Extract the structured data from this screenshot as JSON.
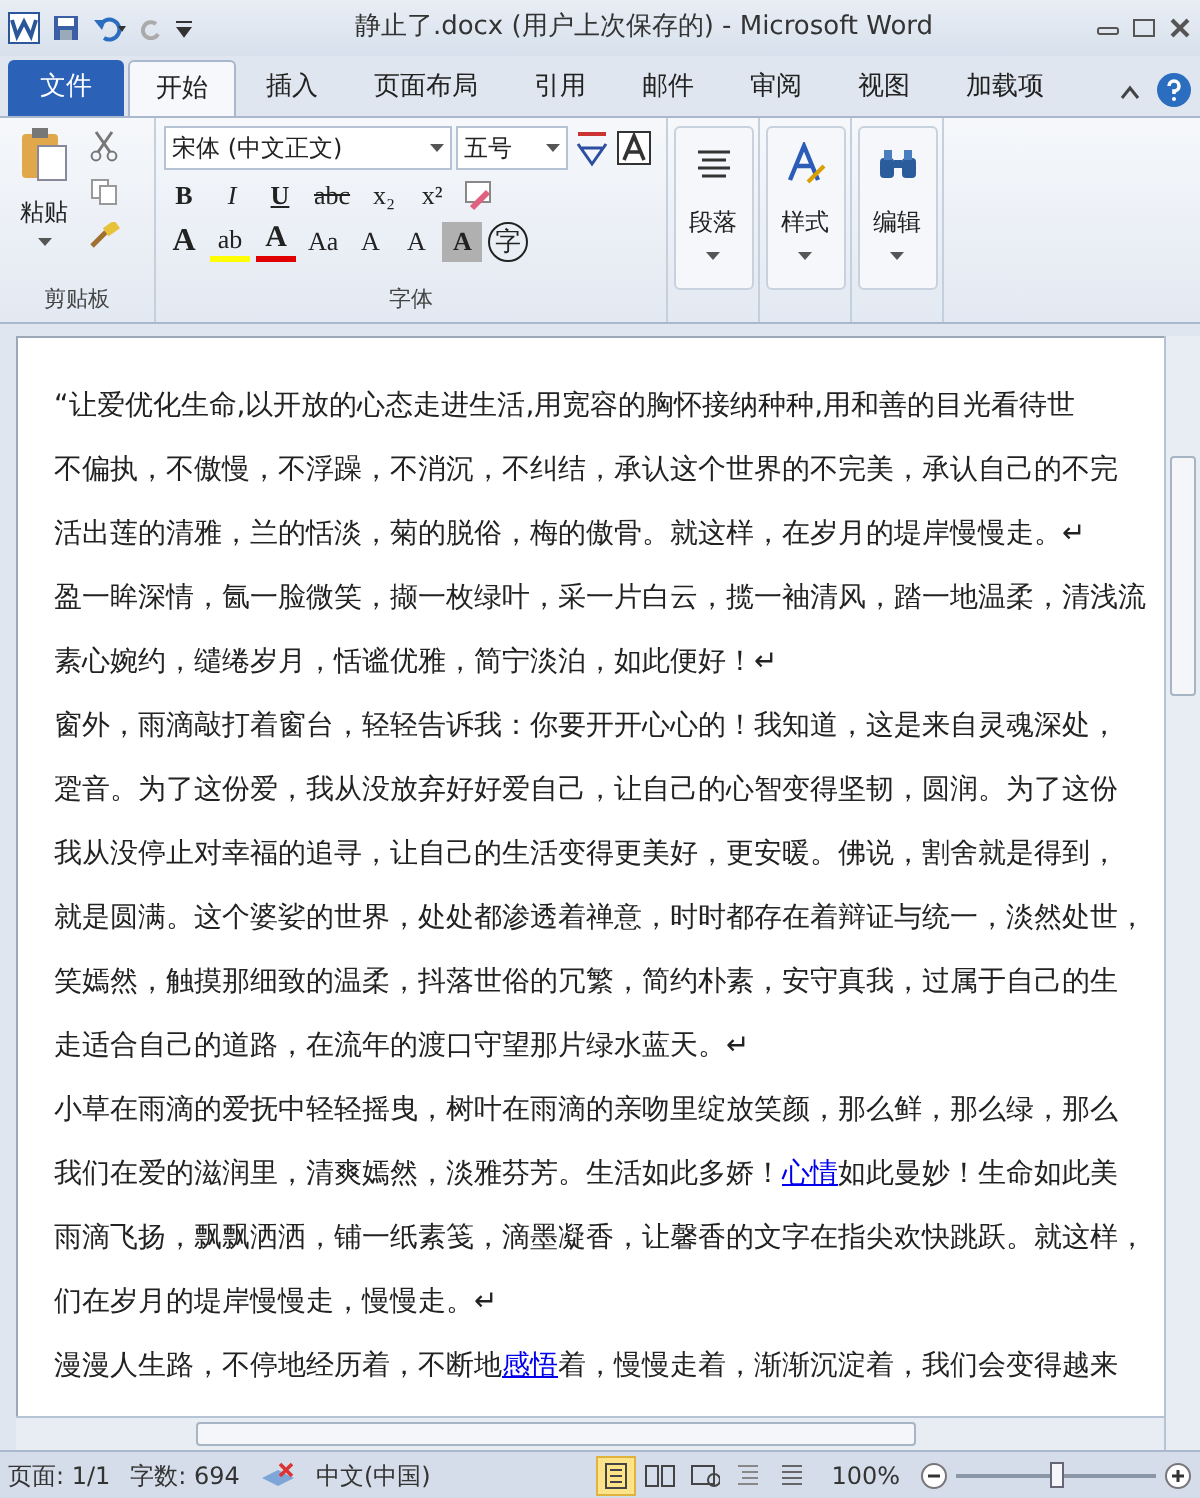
{
  "window": {
    "title": "静止了.docx (用户上次保存的)  -  Microsoft Word"
  },
  "tabs": [
    {
      "label": "文件",
      "kind": "file",
      "selected": false
    },
    {
      "label": "开始",
      "kind": "tab",
      "selected": true
    },
    {
      "label": "插入",
      "kind": "tab",
      "selected": false
    },
    {
      "label": "页面布局",
      "kind": "tab",
      "selected": false
    },
    {
      "label": "引用",
      "kind": "tab",
      "selected": false
    },
    {
      "label": "邮件",
      "kind": "tab",
      "selected": false
    },
    {
      "label": "审阅",
      "kind": "tab",
      "selected": false
    },
    {
      "label": "视图",
      "kind": "tab",
      "selected": false
    },
    {
      "label": "加载项",
      "kind": "tab",
      "selected": false
    }
  ],
  "ribbon": {
    "clipboard": {
      "paste": "粘贴",
      "label": "剪贴板"
    },
    "font": {
      "name": "宋体 (中文正文)",
      "size": "五号",
      "label": "字体",
      "row1": [
        {
          "text": "B",
          "kind": "bold"
        },
        {
          "text": "I",
          "kind": "italic"
        },
        {
          "text": "U",
          "kind": "underline"
        },
        {
          "text": "abc",
          "kind": "strike"
        },
        {
          "text": "x₂",
          "kind": "plain"
        },
        {
          "text": "x²",
          "kind": "plain"
        }
      ],
      "row2": [
        {
          "text": "A",
          "kind": "effect"
        },
        {
          "text": "ab",
          "kind": "highlight"
        },
        {
          "text": "A",
          "kind": "color"
        },
        {
          "text": "Aa",
          "kind": "plain"
        },
        {
          "text": "A",
          "kind": "plain"
        },
        {
          "text": "A",
          "kind": "plain"
        },
        {
          "text": "A",
          "kind": "shade"
        },
        {
          "text": "字",
          "kind": "circle"
        }
      ]
    },
    "groups": [
      {
        "label": "段落",
        "kind": "paragraph"
      },
      {
        "label": "样式",
        "kind": "styles"
      },
      {
        "label": "编辑",
        "kind": "editing"
      }
    ]
  },
  "document": {
    "lines": [
      [
        {
          "text": "“让爱优化生命,以开放的心态走进生活,用宽容的胸怀接纳种种,用和善的目光看待世",
          "link": false
        }
      ],
      [
        {
          "text": "不偏执，不傲慢，不浮躁，不消沉，不纠结，承认这个世界的不完美，承认自己的不完",
          "link": false
        }
      ],
      [
        {
          "text": "活出莲的清雅，兰的恬淡，菊的脱俗，梅的傲骨。就这样，在岁月的堤岸慢慢走。↵",
          "link": false
        }
      ],
      [
        {
          "text": "盈一眸深情，氤一脸微笑，撷一枚绿叶，采一片白云，揽一袖清风，踏一地温柔，清浅流",
          "link": false
        }
      ],
      [
        {
          "text": "素心婉约，缱绻岁月，恬谧优雅，简宁淡泊，如此便好！↵",
          "link": false
        }
      ],
      [
        {
          "text": "窗外，雨滴敲打着窗台，轻轻告诉我：你要开开心心的！我知道，这是来自灵魂深处，",
          "link": false
        }
      ],
      [
        {
          "text": "跫音。为了这份爱，我从没放弃好好爱自己，让自己的心智变得坚韧，圆润。为了这份",
          "link": false
        }
      ],
      [
        {
          "text": "我从没停止对幸福的追寻，让自己的生活变得更美好，更安暖。佛说，割舍就是得到，",
          "link": false
        }
      ],
      [
        {
          "text": "就是圆满。这个婆娑的世界，处处都渗透着禅意，时时都存在着辩证与统一，淡然处世，",
          "link": false
        }
      ],
      [
        {
          "text": "笑嫣然，触摸那细致的温柔，抖落世俗的冗繁，简约朴素，安守真我，过属于自己的生",
          "link": false
        }
      ],
      [
        {
          "text": "走适合自己的道路，在流年的渡口守望那片绿水蓝天。↵",
          "link": false
        }
      ],
      [
        {
          "text": "小草在雨滴的爱抚中轻轻摇曳，树叶在雨滴的亲吻里绽放笑颜，那么鲜，那么绿，那么",
          "link": false
        }
      ],
      [
        {
          "text": "我们在爱的滋润里，清爽嫣然，淡雅芬芳。生活如此多娇！",
          "link": false
        },
        {
          "text": "心情",
          "link": true
        },
        {
          "text": "如此曼妙！生命如此美",
          "link": false
        }
      ],
      [
        {
          "text": "雨滴飞扬，飘飘洒洒，铺一纸素笺，滴墨凝香，让馨香的文字在指尖欢快跳跃。就这样，",
          "link": false
        }
      ],
      [
        {
          "text": "们在岁月的堤岸慢慢走，慢慢走。↵",
          "link": false
        }
      ],
      [
        {
          "text": "漫漫人生路，不停地经历着，不断地",
          "link": false
        },
        {
          "text": "感悟",
          "link": true
        },
        {
          "text": "着，慢慢走着，渐渐沉淀着，我们会变得越来",
          "link": false
        }
      ]
    ]
  },
  "status_bar": {
    "page": "页面: 1/1",
    "words": "字数: 694",
    "language": "中文(中国)",
    "zoom": "100%",
    "zoom_slider": {
      "level": 0.5
    },
    "views": [
      {
        "kind": "print",
        "selected": true
      },
      {
        "kind": "read",
        "selected": false
      },
      {
        "kind": "web",
        "selected": false
      },
      {
        "kind": "outline",
        "selected": false
      },
      {
        "kind": "draft",
        "selected": false
      }
    ]
  }
}
